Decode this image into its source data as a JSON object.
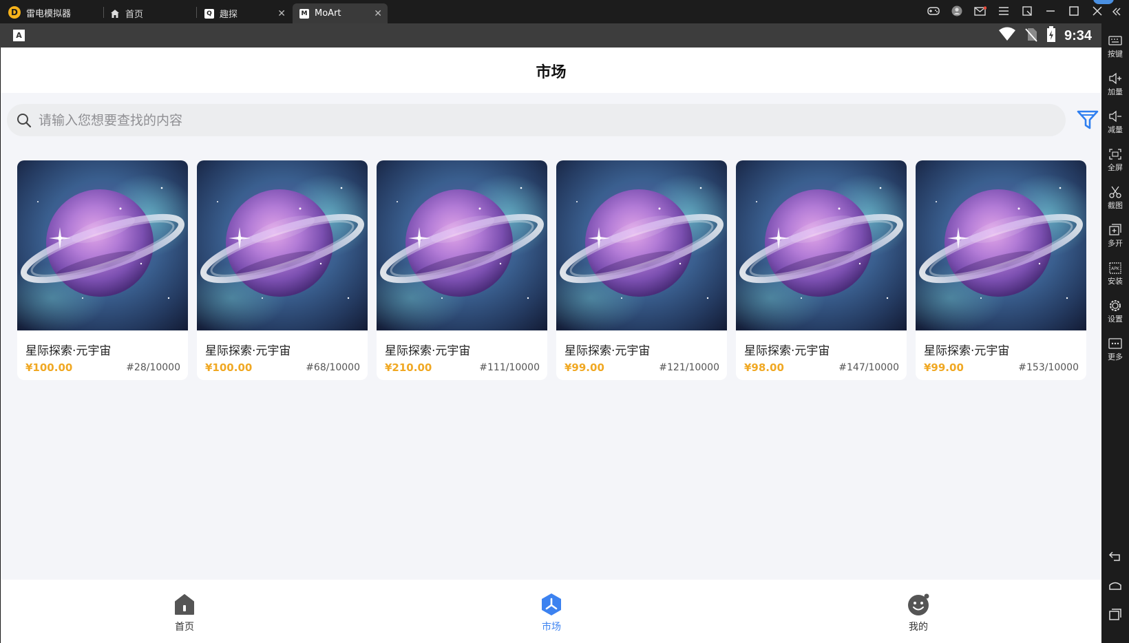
{
  "emulator": {
    "app_name": "雷电模拟器",
    "tabs": [
      {
        "label": "首页",
        "icon": "home-icon"
      },
      {
        "label": "趣探",
        "icon": "app-icon"
      },
      {
        "label": "MoArt",
        "icon": "moart-icon"
      }
    ],
    "side_tools": [
      {
        "label": "按键",
        "icon": "keyboard-icon"
      },
      {
        "label": "加量",
        "icon": "volume-up-icon"
      },
      {
        "label": "减量",
        "icon": "volume-down-icon"
      },
      {
        "label": "全屏",
        "icon": "fullscreen-icon"
      },
      {
        "label": "截图",
        "icon": "scissors-icon"
      },
      {
        "label": "多开",
        "icon": "multi-instance-icon"
      },
      {
        "label": "安装",
        "icon": "apk-icon"
      },
      {
        "label": "设置",
        "icon": "gear-icon"
      },
      {
        "label": "更多",
        "icon": "more-icon"
      }
    ]
  },
  "status": {
    "indicator": "A",
    "time": "9:34"
  },
  "app": {
    "title": "市场",
    "search_placeholder": "请输入您想要查找的内容",
    "items": [
      {
        "name": "星际探索·元宇宙",
        "price": "¥100.00",
        "serial": "#28/10000"
      },
      {
        "name": "星际探索·元宇宙",
        "price": "¥100.00",
        "serial": "#68/10000"
      },
      {
        "name": "星际探索·元宇宙",
        "price": "¥210.00",
        "serial": "#111/10000"
      },
      {
        "name": "星际探索·元宇宙",
        "price": "¥99.00",
        "serial": "#121/10000"
      },
      {
        "name": "星际探索·元宇宙",
        "price": "¥98.00",
        "serial": "#147/10000"
      },
      {
        "name": "星际探索·元宇宙",
        "price": "¥99.00",
        "serial": "#153/10000"
      }
    ],
    "tabbar": [
      {
        "label": "首页",
        "icon": "home-icon",
        "active": false
      },
      {
        "label": "市场",
        "icon": "market-icon",
        "active": true
      },
      {
        "label": "我的",
        "icon": "profile-icon",
        "active": false
      }
    ],
    "colors": {
      "accent": "#3c82f0",
      "price": "#f0a823"
    }
  }
}
